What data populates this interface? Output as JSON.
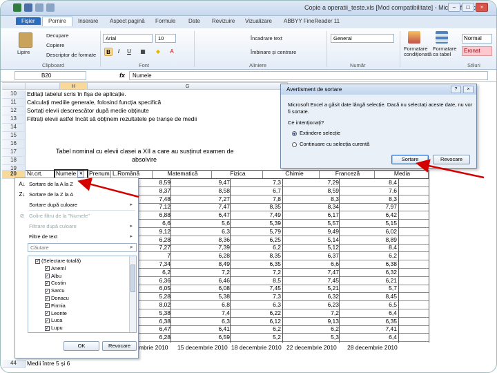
{
  "window": {
    "title": "Copie a operatii_teste.xls [Mod compatibilitate] - Microsoft Excel",
    "controls": [
      "–",
      "□",
      "×"
    ]
  },
  "tabs": [
    "Fișier",
    "Pornire",
    "Inserare",
    "Aspect pagină",
    "Formule",
    "Date",
    "Revizuire",
    "Vizualizare",
    "ABBYY FineReader 11"
  ],
  "ribbon": {
    "paste": "Lipire",
    "cut": "Decupare",
    "copy": "Copiere",
    "format_painter": "Descriptor de formate",
    "clipboard_group": "Clipboard",
    "font_name": "Arial",
    "font_size": "10",
    "font_group": "Font",
    "wrap_text": "Încadrare text",
    "merge_center": "Îmbinare și centrare",
    "align_group": "Aliniere",
    "number_format": "General",
    "number_group": "Număr",
    "cond_format": "Formatare condiționată",
    "format_table": "Formatare ca tabel",
    "style_normal": "Normal",
    "style_bad": "Eronat",
    "styles_group": "Stiluri"
  },
  "formula_bar": {
    "name_box": "B20",
    "fx": "fx",
    "value": "Numele"
  },
  "columns": [
    "H",
    "G"
  ],
  "rows_top": [
    {
      "num": "10",
      "text": "Editați tabelul scris în fișa de aplicație."
    },
    {
      "num": "11",
      "text": "Calculați mediile generale, folosind funcția specifică"
    },
    {
      "num": "12",
      "text": "Sortați elevii descrescător după medie obținute"
    },
    {
      "num": "13",
      "text": "Filtrați elevii astfel încât să obținem rezultatele pe tranșe de medii"
    },
    {
      "num": "14",
      "text": ""
    },
    {
      "num": "15",
      "text": ""
    },
    {
      "num": "16",
      "text": ""
    },
    {
      "num": "17",
      "text": "Tabel nominal cu elevii clasei a XII a care au susținut examen de"
    },
    {
      "num": "18",
      "text": "absolvire"
    },
    {
      "num": "19",
      "text": ""
    },
    {
      "num": "20",
      "text": ""
    }
  ],
  "table_header": [
    "Nr.crt.",
    "Numele",
    "Prenum",
    "L.Română",
    "Matematică",
    "Fizica",
    "Chimie",
    "Franceză",
    "Media"
  ],
  "table_rows": [
    [
      "8,59",
      "9,47",
      "7,3",
      "7,29",
      "8,4"
    ],
    [
      "8,37",
      "8,58",
      "6,7",
      "8,59",
      "7,6"
    ],
    [
      "7,48",
      "7,27",
      "7,8",
      "8,3",
      "8,3"
    ],
    [
      "7,12",
      "7,47",
      "8,35",
      "8,34",
      "7,97"
    ],
    [
      "6,88",
      "6,47",
      "7,49",
      "6,17",
      "6,42"
    ],
    [
      "6,6",
      "5,6",
      "5,39",
      "5,57",
      "5,15"
    ],
    [
      "9,12",
      "6,3",
      "5,79",
      "9,49",
      "6,02"
    ],
    [
      "6,28",
      "8,36",
      "6,25",
      "5,14",
      "8,89"
    ],
    [
      "7,27",
      "7,39",
      "6,2",
      "5,12",
      "8,4"
    ],
    [
      "7",
      "6,28",
      "8,35",
      "6,37",
      "6,2"
    ],
    [
      "7,34",
      "8,49",
      "6,35",
      "6,6",
      "6,38"
    ],
    [
      "6,2",
      "7,2",
      "7,2",
      "7,47",
      "6,32"
    ],
    [
      "6,36",
      "6,46",
      "8,5",
      "7,45",
      "6,21"
    ],
    [
      "6,05",
      "6,08",
      "7,45",
      "5,21",
      "5,7"
    ],
    [
      "5,28",
      "5,38",
      "7,3",
      "6,32",
      "8,45"
    ],
    [
      "8,02",
      "6,8",
      "6,3",
      "6,23",
      "6,5"
    ],
    [
      "5,38",
      "7,4",
      "6,22",
      "7,2",
      "6,4"
    ],
    [
      "6,38",
      "6,3",
      "6,12",
      "9,13",
      "6,35"
    ],
    [
      "6,47",
      "6,41",
      "6,2",
      "6,2",
      "7,41"
    ],
    [
      "6,28",
      "6,59",
      "5,2",
      "5,3",
      "6,4"
    ]
  ],
  "date_row": [
    "mbrie 2010",
    "15 decembrie 2010",
    "18 decembrie 2010",
    "22 decembrie 2010",
    "28 decembrie 2010"
  ],
  "row44": {
    "num": "44",
    "text": "Medii între 5 și 6"
  },
  "filter_menu": {
    "sort_az": "Sortare de la A la Z",
    "sort_za": "Sortare de la Z la A",
    "sort_color": "Sortare după culoare",
    "clear_filter": "Golire filtru de la \"Numele\"",
    "filter_color": "Filtrare după culoare",
    "text_filters": "Filtre de text",
    "search_placeholder": "Căutare",
    "items": [
      "(Selectare totală)",
      "Aneml",
      "Albu",
      "Costin",
      "Sarcu",
      "Donacu",
      "Firmia",
      "Leonte",
      "Luca",
      "Lupu"
    ],
    "ok": "OK",
    "cancel": "Revocare"
  },
  "dialog": {
    "title": "Avertisment de sortare",
    "message": "Microsoft Excel a găsit date lângă selecție. Dacă nu selectați aceste date, nu vor fi sortate.",
    "question": "Ce intenționați?",
    "option1": "Extindere selecție",
    "option2": "Continuare cu selecția curentă",
    "sort": "Sortare",
    "cancel": "Revocare",
    "help": "?",
    "close": "×"
  }
}
